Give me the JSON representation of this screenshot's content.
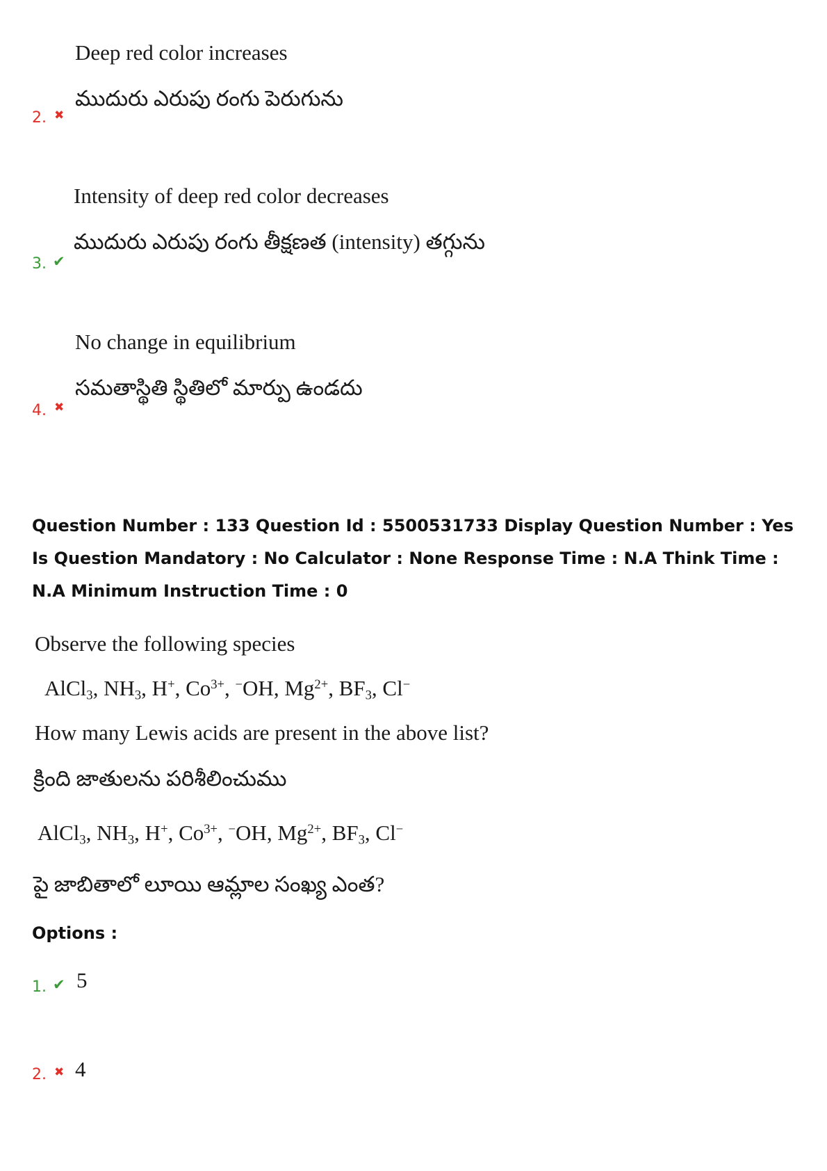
{
  "prev_options": [
    {
      "number": "2.",
      "status": "wrong",
      "mark": "✖",
      "en": "Deep red color increases",
      "te": "ముదురు ఎరుపు రంగు పెరుగును"
    },
    {
      "number": "3.",
      "status": "right",
      "mark": "✔",
      "en": "Intensity of deep red color decreases",
      "te": "ముదురు ఎరుపు రంగు తీక్షణత (intensity) తగ్గును"
    },
    {
      "number": "4.",
      "status": "wrong",
      "mark": "✖",
      "en": "No change in equilibrium",
      "te": "సమతాస్థితి స్థితిలో మార్పు ఉండదు"
    }
  ],
  "question_meta": "Question Number : 133 Question Id : 5500531733 Display Question Number : Yes Is Question Mandatory : No Calculator : None Response Time : N.A Think Time : N.A Minimum Instruction Time : 0",
  "question": {
    "en_intro": "Observe the following species",
    "species_parts": {
      "alcl": "AlCl",
      "n3": "3",
      "nh": ", NH",
      "n3b": "3",
      "h": ", H",
      "plus": "+",
      "co": ", Co",
      "co_charge": "3+",
      "oh": ", ",
      "minus": "−",
      "oh2": "OH, Mg",
      "mg_charge": "2+",
      "bf": ", BF",
      "n3c": "3",
      "cl": ", Cl",
      "minus2": "−"
    },
    "en_question": "How many Lewis acids are present in the above list?",
    "te_intro": "క్రింది జాతులను పరిశీలించుము",
    "te_question": "పై జాబితాలో లూయి ఆమ్లాల సంఖ్య ఎంత?"
  },
  "options_label": "Options :",
  "options": [
    {
      "number": "1.",
      "status": "right",
      "mark": "✔",
      "value": "5"
    },
    {
      "number": "2.",
      "status": "wrong",
      "mark": "✖",
      "value": "4"
    }
  ]
}
